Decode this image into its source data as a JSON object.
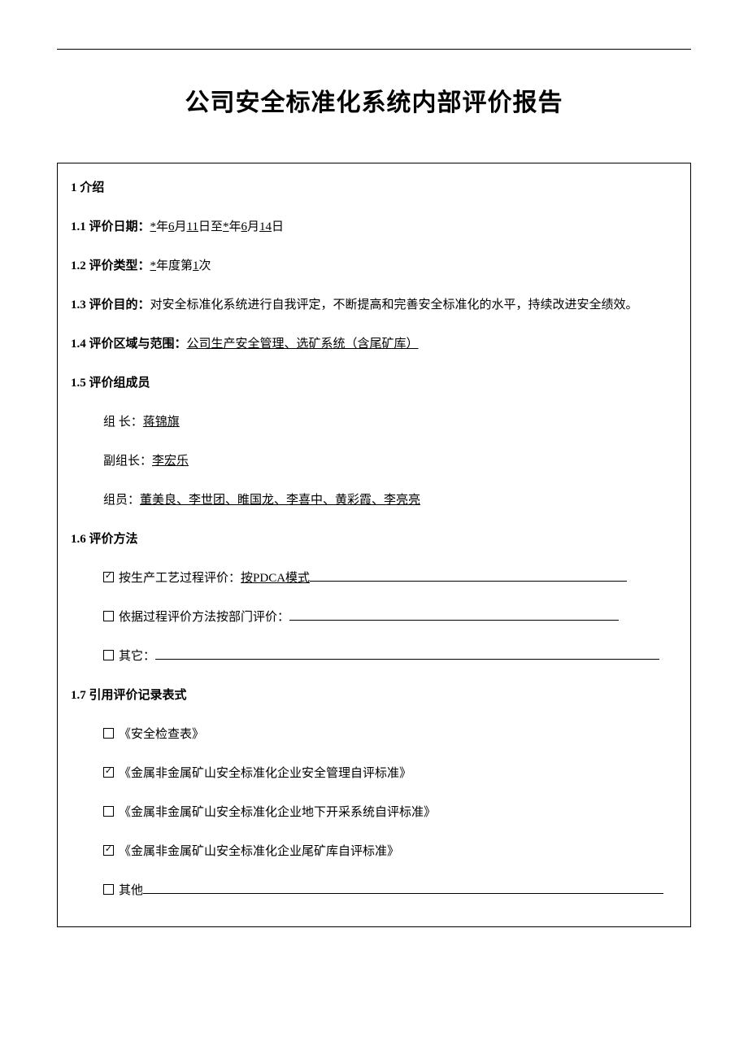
{
  "title": "公司安全标准化系统内部评价报告",
  "s1": {
    "heading": "1  介绍",
    "s1_1_label": "1.1 评价日期：",
    "date_parts": {
      "p1": "*",
      "p2": "年",
      "p3": "6",
      "p4": "月",
      "p5": "11",
      "p6": "日至",
      "p7": "*",
      "p8": "年",
      "p9": "6",
      "p10": "月",
      "p11": "14",
      "p12": "日"
    },
    "s1_2_label": "1.2 评价类型：",
    "type_parts": {
      "p1": "*",
      "p2": "年度第",
      "p3": "1",
      "p4": "次"
    },
    "s1_3_label": "1.3 评价目的：",
    "s1_3_text": "对安全标准化系统进行自我评定，不断提高和完善安全标准化的水平，持续改进安全绩效。",
    "s1_4_label": "1.4 评价区域与范围：",
    "s1_4_text": "公司生产安全管理、选矿系统（含尾矿库）",
    "s1_5_label": "1.5 评价组成员",
    "leader_label": "组   长：",
    "leader": "蒋锦旗",
    "vice_label": "副组长：",
    "vice": "李宏乐",
    "member_label": "组员：",
    "members": "董美良、李世团、睢国龙、李喜中、黄彩霞、李亮亮",
    "s1_6_label": "1.6 评价方法",
    "m1_label": "按生产工艺过程评价：",
    "m1_value": "按PDCA模式",
    "m2_label": "依据过程评价方法按部门评价：",
    "m3_label": "其它：",
    "s1_7_label": "1.7 引用评价记录表式",
    "r1": "《安全检查表》",
    "r2": "《金属非金属矿山安全标准化企业安全管理自评标准》",
    "r3": "《金属非金属矿山安全标准化企业地下开采系统自评标准》",
    "r4": "《金属非金属矿山安全标准化企业尾矿库自评标准》",
    "r5_label": "其他"
  }
}
